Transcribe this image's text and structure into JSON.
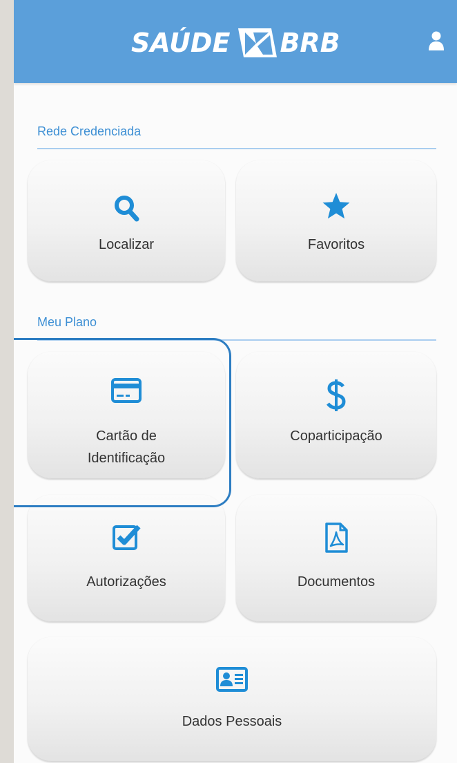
{
  "header": {
    "logo_text_left": "SAÚDE",
    "logo_text_right": "BRB",
    "user_icon": "user-icon"
  },
  "sections": {
    "rede": {
      "title": "Rede Credenciada"
    },
    "plano": {
      "title": "Meu Plano"
    }
  },
  "tiles": {
    "localizar": {
      "label": "Localizar",
      "icon": "search-icon"
    },
    "favoritos": {
      "label": "Favoritos",
      "icon": "star-icon"
    },
    "cartao": {
      "label_line1": "Cartão de",
      "label_line2": "Identificação",
      "icon": "credit-card-icon"
    },
    "coparticipacao": {
      "label": "Coparticipação",
      "icon": "dollar-icon"
    },
    "autorizacoes": {
      "label": "Autorizações",
      "icon": "checkbox-icon"
    },
    "documentos": {
      "label": "Documentos",
      "icon": "pdf-document-icon"
    },
    "dados": {
      "label": "Dados Pessoais",
      "icon": "id-card-icon"
    }
  },
  "colors": {
    "header": "#5b9fda",
    "accent": "#1f8dd6",
    "section_title": "#3d8fd4",
    "highlight": "#2d7dc2"
  }
}
